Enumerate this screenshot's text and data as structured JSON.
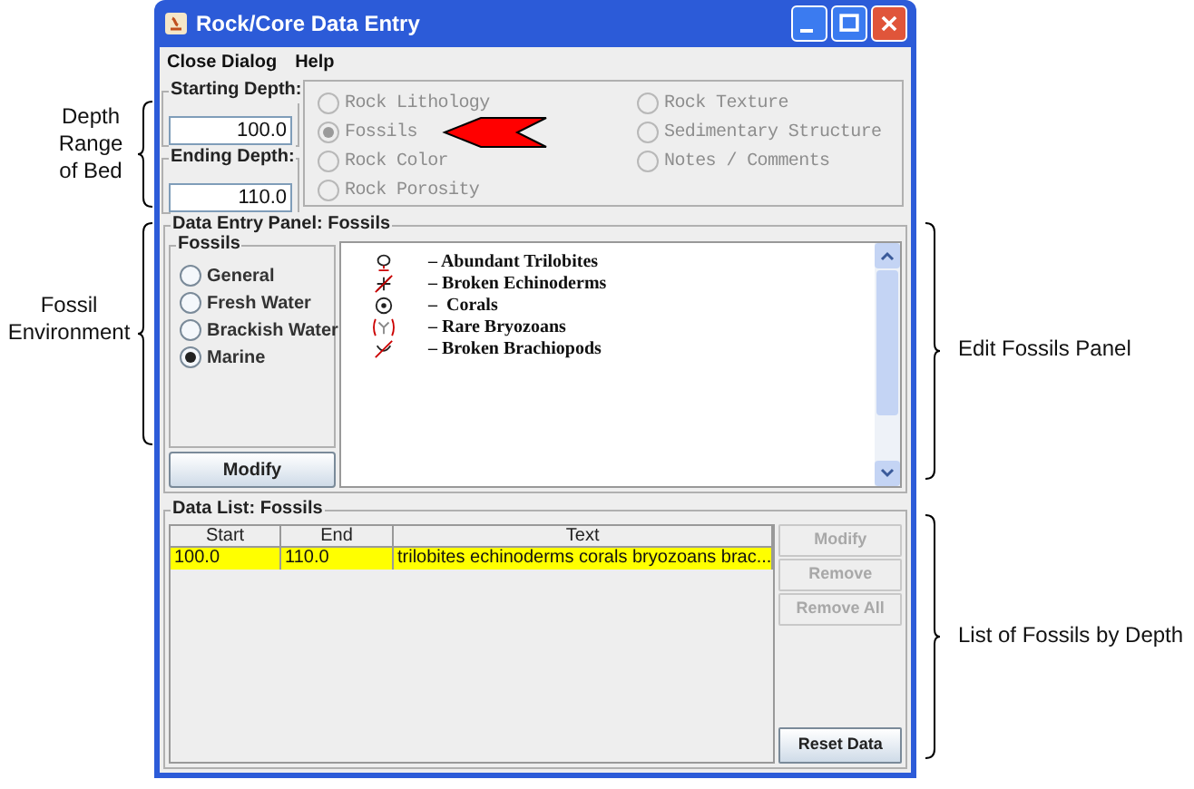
{
  "window": {
    "title": "Rock/Core Data Entry"
  },
  "menu": [
    {
      "label": "Close Dialog"
    },
    {
      "label": "Help"
    }
  ],
  "depth": [
    {
      "label": "Starting Depth:",
      "value": "100.0"
    },
    {
      "label": "Ending Depth:",
      "value": "110.0"
    }
  ],
  "data_types": [
    {
      "label": "Rock Lithology",
      "selected": false,
      "disabled": true
    },
    {
      "label": "Rock Texture",
      "selected": false,
      "disabled": true
    },
    {
      "label": "Fossils",
      "selected": true,
      "disabled": true
    },
    {
      "label": "Sedimentary Structure",
      "selected": false,
      "disabled": true
    },
    {
      "label": "Rock Color",
      "selected": false,
      "disabled": true
    },
    {
      "label": "Notes / Comments",
      "selected": false,
      "disabled": true
    },
    {
      "label": "Rock Porosity",
      "selected": false,
      "disabled": true
    }
  ],
  "entry_panel": {
    "title": "Data Entry Panel: Fossils",
    "group_title": "Fossils",
    "environments": [
      {
        "label": "General",
        "selected": false
      },
      {
        "label": "Fresh Water",
        "selected": false
      },
      {
        "label": "Brackish Water",
        "selected": false
      },
      {
        "label": "Marine",
        "selected": true
      }
    ],
    "modify_button": "Modify",
    "fossils": [
      {
        "kind": "trilobite",
        "text": "– Abundant Trilobites"
      },
      {
        "kind": "echinoderm",
        "text": "– Broken Echinoderms"
      },
      {
        "kind": "coral",
        "text": "–  Corals"
      },
      {
        "kind": "bryozoan",
        "text": "– Rare Bryozoans"
      },
      {
        "kind": "brachiopod",
        "text": "– Broken Brachiopods"
      }
    ]
  },
  "data_list": {
    "title": "Data List: Fossils",
    "columns": [
      "Start",
      "End",
      "Text"
    ],
    "rows": [
      {
        "cells": [
          "100.0",
          "110.0",
          "trilobites echinoderms corals bryozoans brac..."
        ],
        "selected": true
      }
    ],
    "buttons": [
      {
        "label": "Modify",
        "disabled": true
      },
      {
        "label": "Remove",
        "disabled": true
      },
      {
        "label": "Remove All",
        "disabled": true
      },
      {
        "label": "Reset Data",
        "disabled": false
      }
    ]
  },
  "notes_left": [
    "Depth Range of Bed",
    "Fossil Environment"
  ],
  "notes_right": [
    "Edit Fossils Panel",
    "List of Fossils by Depth"
  ]
}
